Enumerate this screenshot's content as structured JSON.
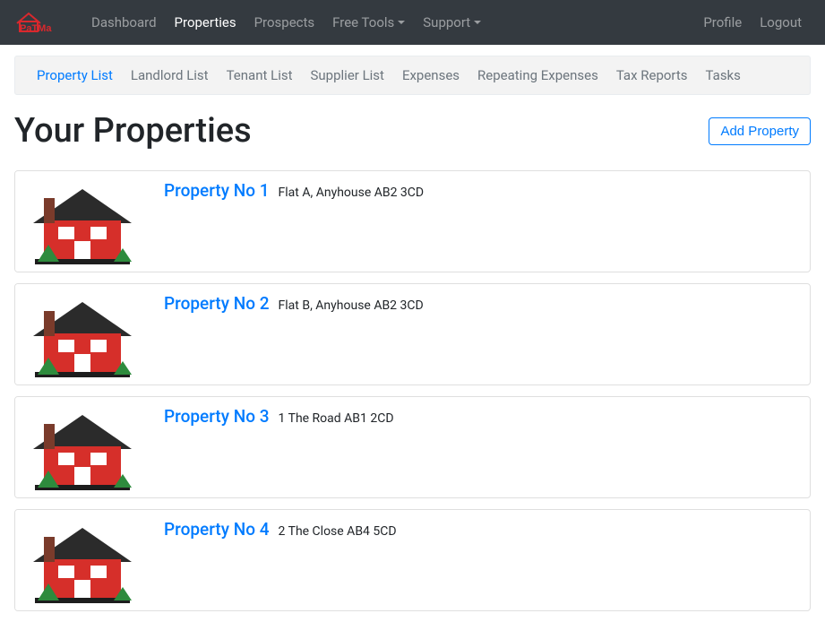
{
  "brand": "PaTMa",
  "nav": {
    "dashboard": "Dashboard",
    "properties": "Properties",
    "prospects": "Prospects",
    "free_tools": "Free Tools",
    "support": "Support",
    "profile": "Profile",
    "logout": "Logout"
  },
  "subnav": {
    "property_list": "Property List",
    "landlord_list": "Landlord List",
    "tenant_list": "Tenant List",
    "supplier_list": "Supplier List",
    "expenses": "Expenses",
    "repeating_expenses": "Repeating Expenses",
    "tax_reports": "Tax Reports",
    "tasks": "Tasks"
  },
  "page": {
    "title": "Your Properties",
    "add_button": "Add Property"
  },
  "properties": [
    {
      "name": "Property No 1",
      "address": "Flat A, Anyhouse AB2 3CD"
    },
    {
      "name": "Property No 2",
      "address": "Flat B, Anyhouse AB2 3CD"
    },
    {
      "name": "Property No 3",
      "address": "1 The Road AB1 2CD"
    },
    {
      "name": "Property No 4",
      "address": "2 The Close AB4 5CD"
    }
  ],
  "colors": {
    "brand_red": "#d9282d",
    "link_blue": "#007bff"
  }
}
